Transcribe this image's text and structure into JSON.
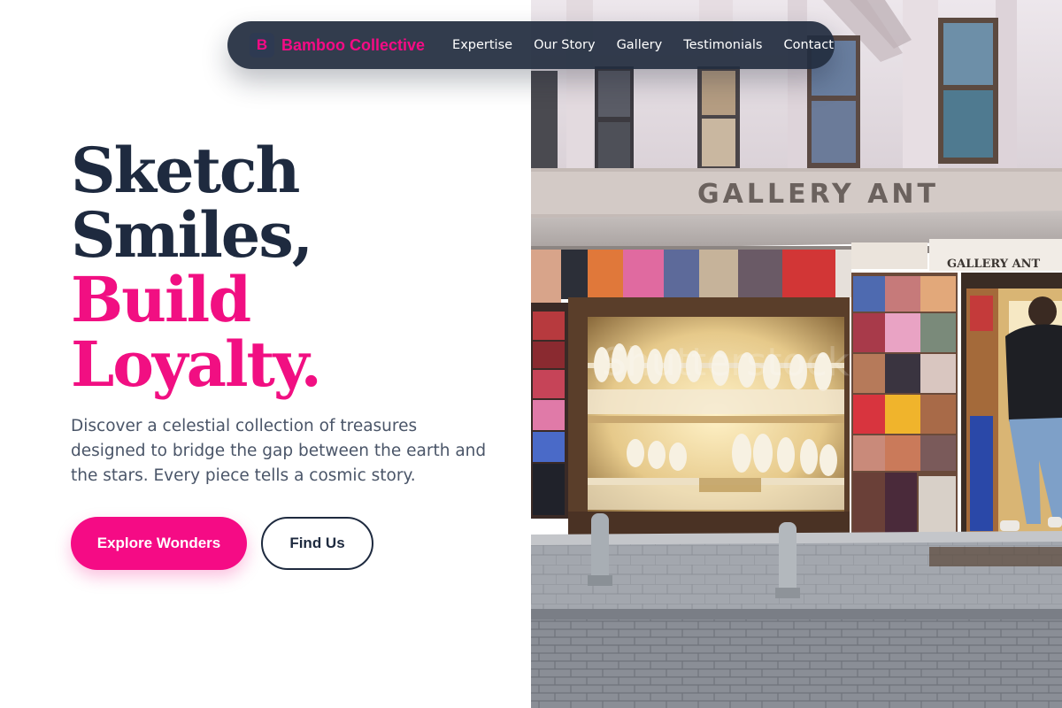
{
  "nav": {
    "brand_mark": "B",
    "brand_name": "Bamboo Collective",
    "links": [
      {
        "label": "Expertise"
      },
      {
        "label": "Our Story"
      },
      {
        "label": "Gallery"
      },
      {
        "label": "Testimonials"
      },
      {
        "label": "Contact"
      }
    ]
  },
  "hero": {
    "headline": {
      "line1": "Sketch",
      "line2": "Smiles,",
      "line3": "Build",
      "line4": "Loyalty."
    },
    "lead": "Discover a celestial collection of treasures designed to bridge the gap between the earth and the stars. Every piece tells a cosmic story.",
    "primary_cta": "Explore Wonders",
    "secondary_cta": "Find Us"
  },
  "photo": {
    "sign_main": "GALLERY ANT",
    "sign_small": "GALLERY ANT",
    "watermark": "Shutterstock"
  },
  "colors": {
    "accent_pink": "#f50b85",
    "headline_dark": "#1e2a3f",
    "nav_background": "#222d40",
    "body_text": "#4a5568"
  }
}
